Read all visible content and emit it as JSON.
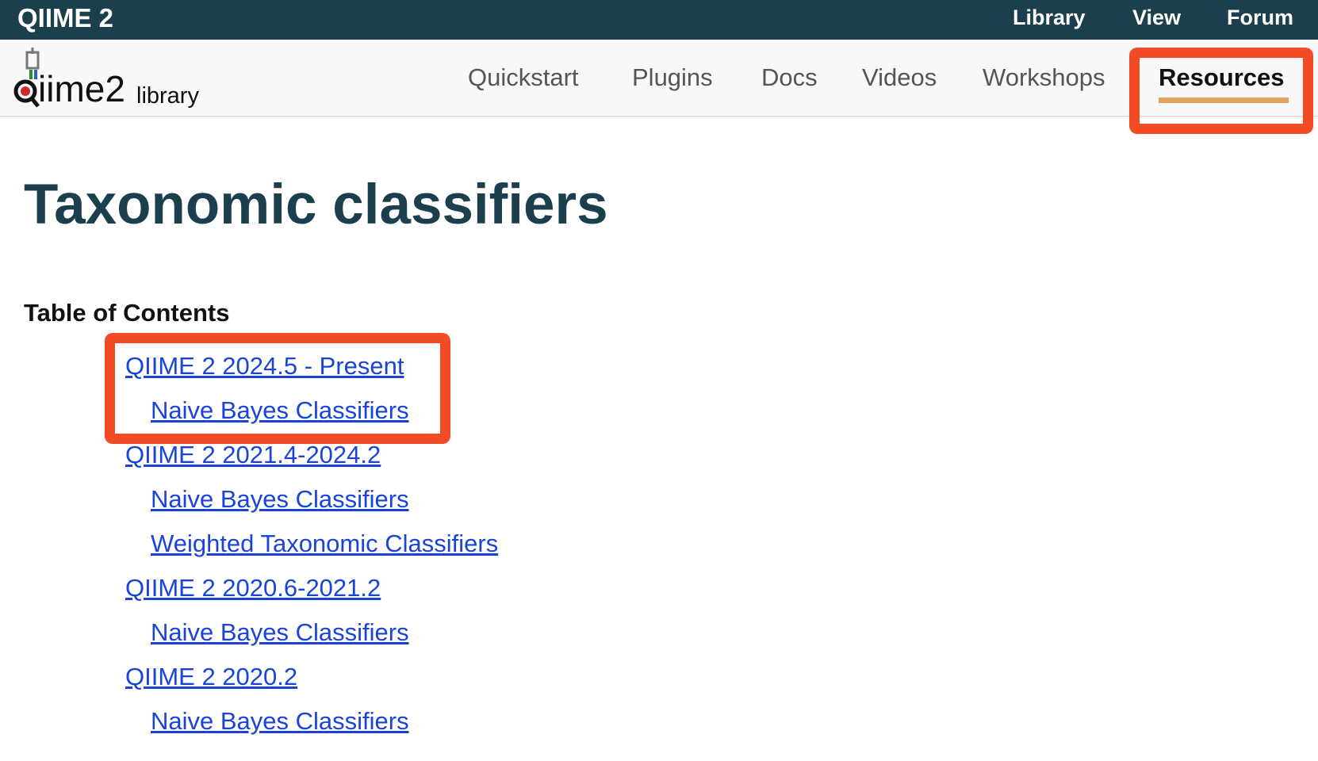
{
  "topbar": {
    "brand": "QIIME 2",
    "links": [
      "Library",
      "View",
      "Forum"
    ]
  },
  "logo": {
    "text_main": "qiime2",
    "text_sub": "library"
  },
  "nav": {
    "items": [
      "Quickstart",
      "Plugins",
      "Docs",
      "Videos",
      "Workshops",
      "Resources"
    ],
    "active": "Resources"
  },
  "page": {
    "title": "Taxonomic classifiers"
  },
  "toc": {
    "title": "Table of Contents",
    "items": [
      {
        "label": "QIIME 2 2024.5 - Present",
        "level": 1
      },
      {
        "label": "Naive Bayes Classifiers",
        "level": 2
      },
      {
        "label": "QIIME 2 2021.4-2024.2",
        "level": 1
      },
      {
        "label": "Naive Bayes Classifiers",
        "level": 2
      },
      {
        "label": "Weighted Taxonomic Classifiers",
        "level": 2
      },
      {
        "label": "QIIME 2 2020.6-2021.2",
        "level": 1
      },
      {
        "label": "Naive Bayes Classifiers",
        "level": 2
      },
      {
        "label": "QIIME 2 2020.2",
        "level": 1
      },
      {
        "label": "Naive Bayes Classifiers",
        "level": 2
      }
    ]
  },
  "colors": {
    "topbar": "#1c3f4e",
    "title": "#1c3f4e",
    "link": "#1a44d9",
    "highlight": "#f24b25",
    "active_underline": "#e0a35f"
  }
}
